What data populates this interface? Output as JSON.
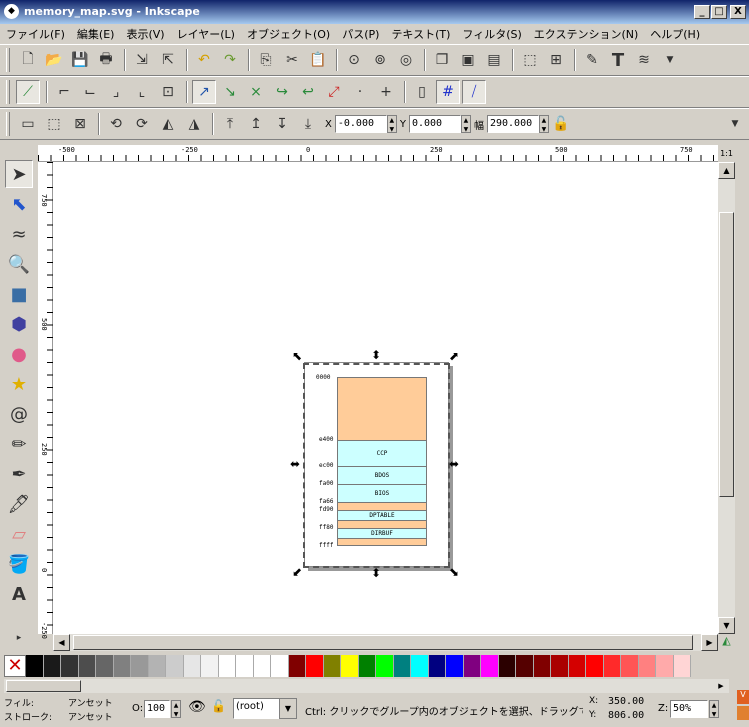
{
  "window": {
    "title": "memory_map.svg - Inkscape",
    "minimize": "_",
    "maximize": "□",
    "close": "X"
  },
  "menu": [
    "ファイル(F)",
    "編集(E)",
    "表示(V)",
    "レイヤー(L)",
    "オブジェクト(O)",
    "パス(P)",
    "テキスト(T)",
    "フィルタ(S)",
    "エクステンション(N)",
    "ヘルプ(H)"
  ],
  "toolbar3": {
    "x_label": "X",
    "x_value": "-0.000",
    "y_label": "Y",
    "y_value": "0.000",
    "w_label": "幅",
    "w_value": "290.000"
  },
  "ruler_h": [
    "-500",
    "-250",
    "0",
    "250",
    "500",
    "750"
  ],
  "ruler_v": [
    "750",
    "500",
    "250",
    "0",
    "-250"
  ],
  "ruler_corner": "1:1",
  "memory_map": {
    "addresses": [
      "0000",
      "e400",
      "ec00",
      "fa00",
      "fa66",
      "fd90",
      "ff80",
      "ffff"
    ],
    "blocks": [
      {
        "label": "",
        "color": "#ffcc99"
      },
      {
        "label": "CCP",
        "color": "#ccffff"
      },
      {
        "label": "BDOS",
        "color": "#ccffff"
      },
      {
        "label": "BIOS",
        "color": "#ccffff"
      },
      {
        "label": "",
        "color": "#ffcc99"
      },
      {
        "label": "DPTABLE",
        "color": "#ccffff"
      },
      {
        "label": "",
        "color": "#ffcc99"
      },
      {
        "label": "DIRBUF",
        "color": "#ccffff"
      },
      {
        "label": "",
        "color": "#ffcc99"
      }
    ]
  },
  "palette": [
    "#000000",
    "#1a1a1a",
    "#333333",
    "#4d4d4d",
    "#666666",
    "#808080",
    "#999999",
    "#b3b3b3",
    "#cccccc",
    "#e6e6e6",
    "#f2f2f2",
    "#ffffff",
    "#ffffff",
    "#ffffff",
    "#ffffff",
    "#800000",
    "#ff0000",
    "#808000",
    "#ffff00",
    "#008000",
    "#00ff00",
    "#008080",
    "#00ffff",
    "#000080",
    "#0000ff",
    "#800080",
    "#ff00ff",
    "#2b0000",
    "#550000",
    "#800000",
    "#aa0000",
    "#d40000",
    "#ff0000",
    "#ff2a2a",
    "#ff5555",
    "#ff8080",
    "#ffaaaa",
    "#ffd5d5"
  ],
  "status": {
    "fill_label": "フィル:",
    "fill_value": "アンセット",
    "stroke_label": "ストローク:",
    "stroke_value": "アンセット",
    "opacity_label": "O:",
    "opacity_value": "100",
    "layer": "(root)",
    "message": "Ctrl: クリックでグループ内のオブジェクトを選択、ドラッグで…",
    "x_label": "X:",
    "x_value": "350.00",
    "y_label": "Y:",
    "y_value": "806.00",
    "zoom_label": "Z:",
    "zoom_value": "50%"
  }
}
